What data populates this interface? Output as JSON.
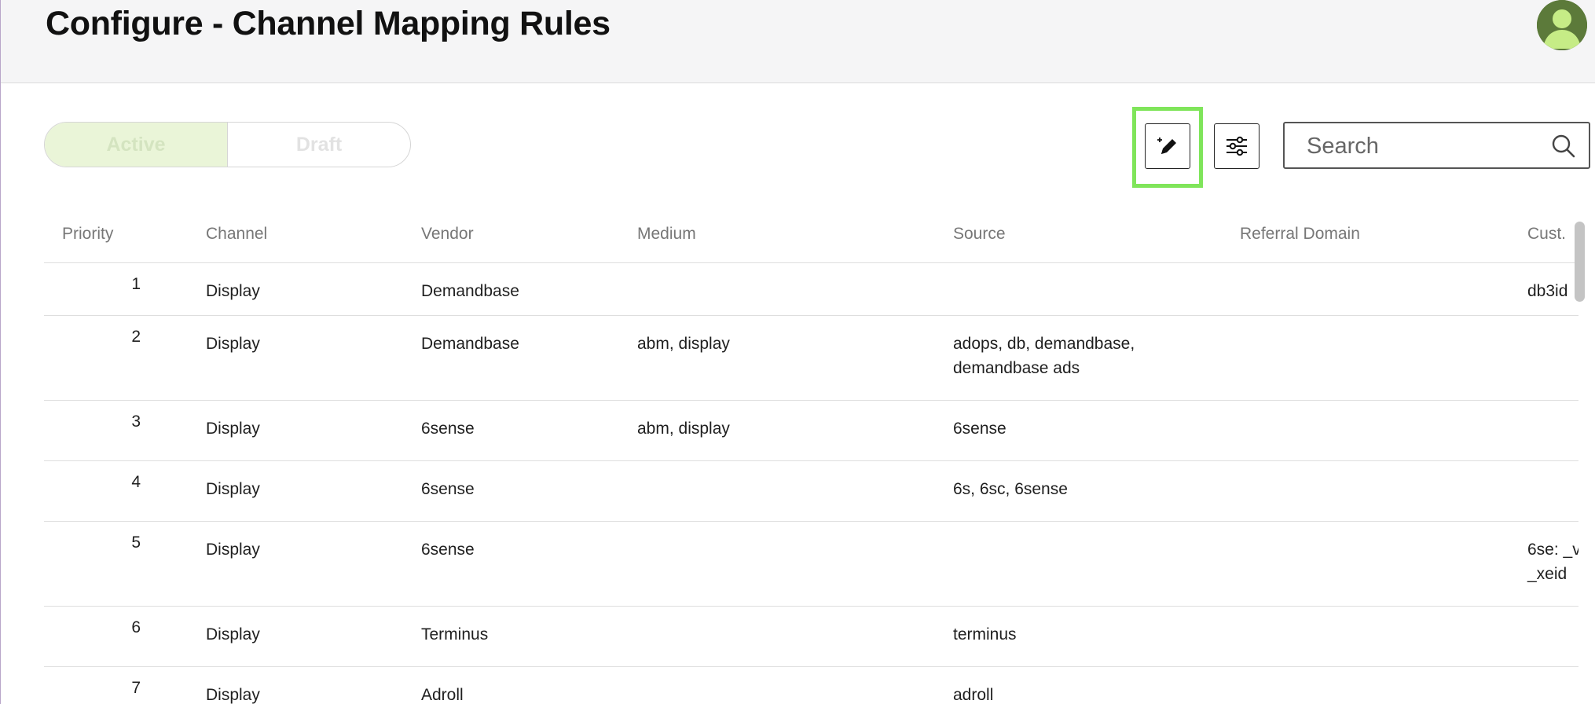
{
  "header": {
    "title": "Configure - Channel Mapping Rules"
  },
  "toggle": {
    "active_label": "Active",
    "draft_label": "Draft"
  },
  "toolbar": {
    "edit_icon": "pencil-sparkle-icon",
    "filter_icon": "sliders-icon",
    "focus_color": "#7fe55a"
  },
  "search": {
    "placeholder": "Search",
    "value": ""
  },
  "table": {
    "columns": [
      "Priority",
      "Channel",
      "Vendor",
      "Medium",
      "Source",
      "Referral Domain",
      "Cust."
    ],
    "rows": [
      {
        "priority": "1",
        "channel": "Display",
        "vendor": "Demandbase",
        "medium": "",
        "source": [
          ""
        ],
        "referral": "",
        "custom": [
          "db3id"
        ]
      },
      {
        "priority": "2",
        "channel": "Display",
        "vendor": "Demandbase",
        "medium": "abm, display",
        "source": [
          "adops, db, demandbase,",
          "demandbase ads"
        ],
        "referral": "",
        "custom": [
          ""
        ]
      },
      {
        "priority": "3",
        "channel": "Display",
        "vendor": "6sense",
        "medium": "abm, display",
        "source": [
          "6sense"
        ],
        "referral": "",
        "custom": [
          ""
        ]
      },
      {
        "priority": "4",
        "channel": "Display",
        "vendor": "6sense",
        "medium": "",
        "source": [
          "6s, 6sc, 6sense"
        ],
        "referral": "",
        "custom": [
          ""
        ]
      },
      {
        "priority": "5",
        "channel": "Display",
        "vendor": "6sense",
        "medium": "",
        "source": [
          ""
        ],
        "referral": "",
        "custom": [
          "6se: _v",
          "_xeid"
        ]
      },
      {
        "priority": "6",
        "channel": "Display",
        "vendor": "Terminus",
        "medium": "",
        "source": [
          "terminus"
        ],
        "referral": "",
        "custom": [
          ""
        ]
      },
      {
        "priority": "7",
        "channel": "Display",
        "vendor": "Adroll",
        "medium": "",
        "source": [
          "adroll"
        ],
        "referral": "",
        "custom": [
          ""
        ]
      }
    ]
  },
  "colors": {
    "active_bg": "#eaf5d8",
    "header_bg": "#f5f5f6",
    "avatar": "#5c7a3a"
  }
}
